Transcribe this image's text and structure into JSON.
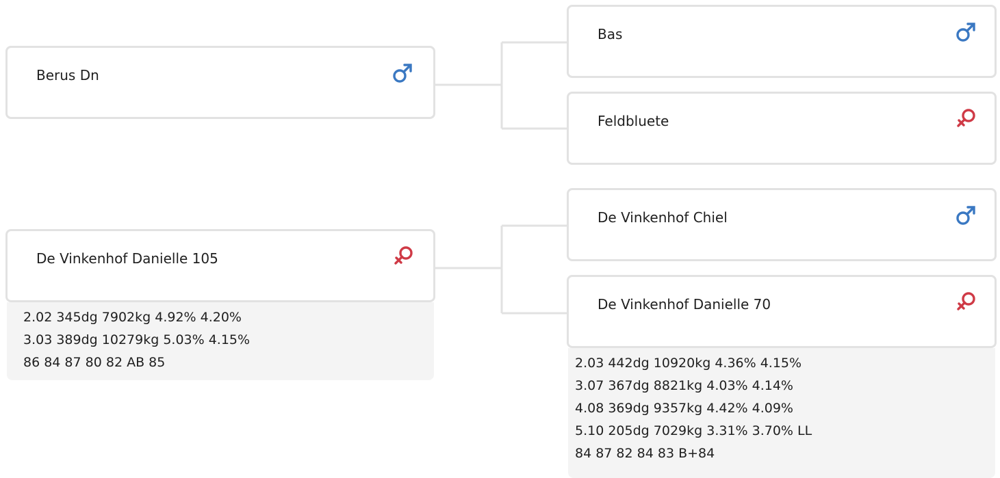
{
  "colors": {
    "male": "#3a78c2",
    "female": "#cf3a46",
    "border": "#e2e2e2",
    "stats_bg": "#f4f4f4"
  },
  "pedigree": {
    "sire": {
      "name": "Berus Dn",
      "sex": "male-symbol-icon",
      "sire": {
        "name": "Bas",
        "sex": "male-symbol-icon"
      },
      "dam": {
        "name": "Feldbluete",
        "sex": "female-symbol-icon"
      }
    },
    "dam": {
      "name": "De Vinkenhof Danielle 105",
      "sex": "female-symbol-icon",
      "stats": [
        "2.02 345dg 7902kg 4.92% 4.20%",
        "3.03 389dg 10279kg 5.03% 4.15%",
        "86 84 87 80 82 AB 85"
      ],
      "sire": {
        "name": "De Vinkenhof Chiel",
        "sex": "male-symbol-icon"
      },
      "dam": {
        "name": "De Vinkenhof Danielle 70",
        "sex": "female-symbol-icon",
        "stats": [
          "2.03 442dg 10920kg 4.36% 4.15%",
          "3.07 367dg 8821kg 4.03% 4.14%",
          "4.08 369dg 9357kg 4.42% 4.09%",
          "5.10 205dg 7029kg 3.31% 3.70% LL",
          "84 87 82 84 83 B+84"
        ]
      }
    }
  }
}
